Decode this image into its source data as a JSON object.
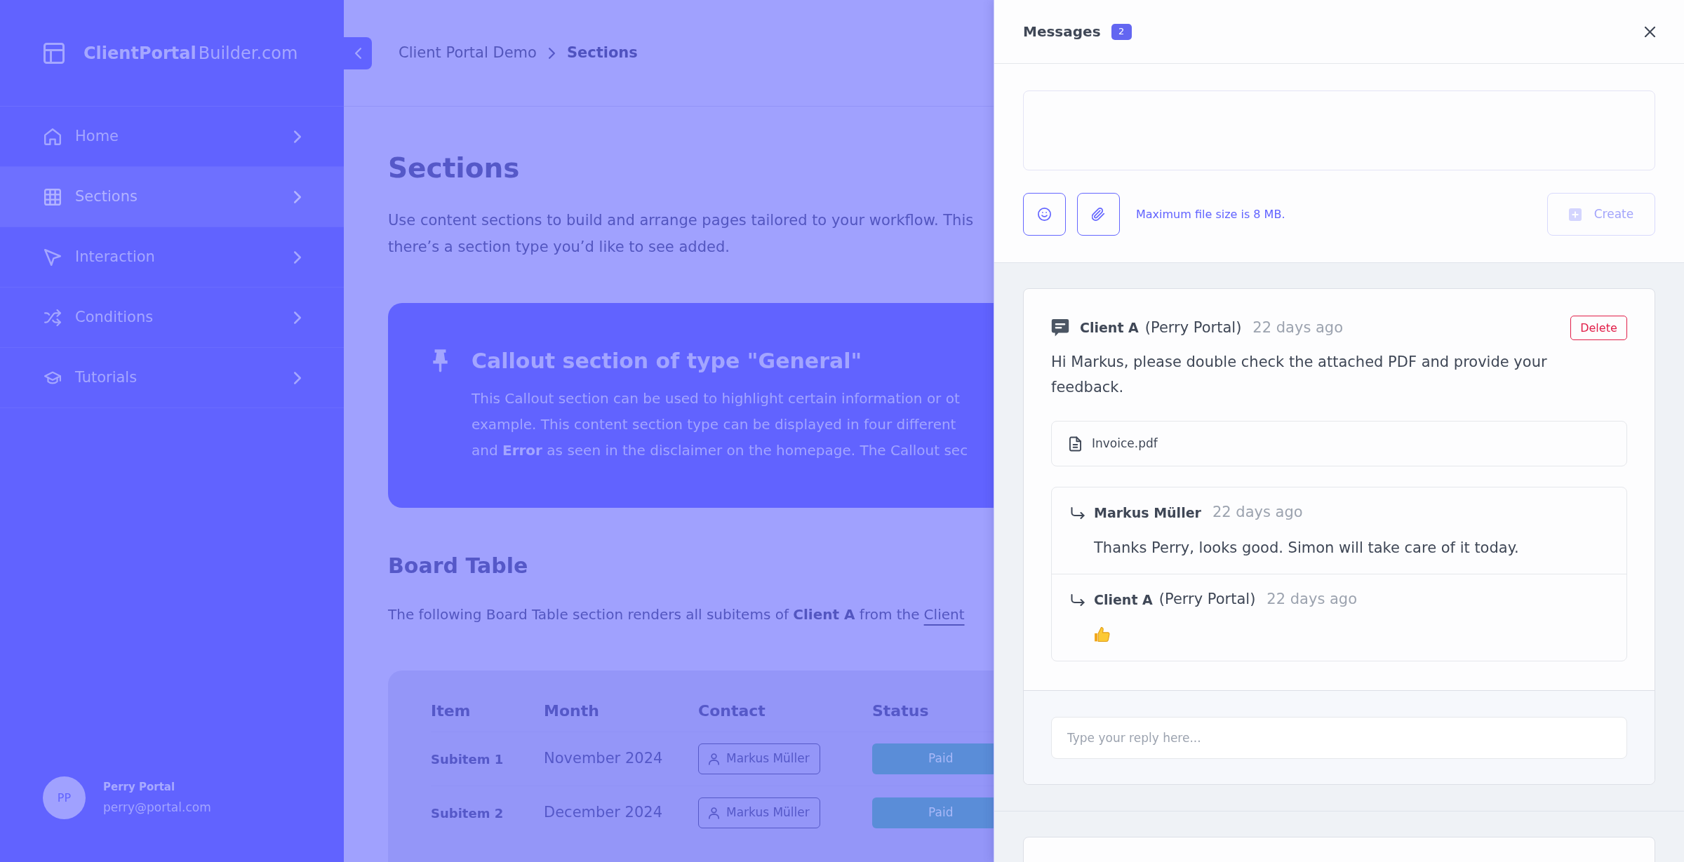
{
  "sidebar": {
    "logo": {
      "bold": "ClientPortal",
      "light": "Builder.com"
    },
    "items": [
      {
        "label": "Home",
        "selected": false
      },
      {
        "label": "Sections",
        "selected": true
      },
      {
        "label": "Interaction",
        "selected": false
      },
      {
        "label": "Conditions",
        "selected": false
      },
      {
        "label": "Tutorials",
        "selected": false
      }
    ],
    "user": {
      "initials": "PP",
      "name": "Perry Portal",
      "email": "perry@portal.com"
    }
  },
  "breadcrumb": [
    {
      "label": "Client Portal Demo",
      "current": false
    },
    {
      "label": "Sections",
      "current": true
    }
  ],
  "page": {
    "title": "Sections",
    "intro_lines": [
      "Use content sections to build and arrange pages tailored to your workflow. This",
      "there’s a section type you’d like to see added."
    ],
    "callout": {
      "title": "Callout section of type \"General\"",
      "lines": [
        "This Callout section can be used to highlight certain information or ot",
        "example. This content section type can be displayed in four different",
        "and **Error** as seen in the disclaimer on the homepage. The Callout sec"
      ]
    },
    "board_table": {
      "title": "Board Table",
      "text": "The following Board Table section renders all subitems of **Client A** from the",
      "link": "Client",
      "columns": [
        "Item",
        "Month",
        "Contact",
        "Status"
      ],
      "rows": [
        {
          "item": "Subitem 1",
          "month": "November 2024",
          "contact": "Markus Müller",
          "status": "Paid"
        },
        {
          "item": "Subitem 2",
          "month": "December 2024",
          "contact": "Markus Müller",
          "status": "Paid"
        }
      ]
    }
  },
  "messages_panel": {
    "title": "Messages",
    "count": "2",
    "composer": {
      "hint": "Maximum file size is 8 MB.",
      "create_label": "Create",
      "create_disabled": true
    },
    "messages": [
      {
        "author": "Client A",
        "org": "(Perry Portal)",
        "time": "22 days ago",
        "delete_label": "Delete",
        "text": "Hi Markus, please double check the attached PDF and provide your feedback.",
        "attachments": [
          "Invoice.pdf"
        ],
        "replies": [
          {
            "kind": "comment",
            "author": "Markus Müller",
            "time": "22 days ago",
            "text": "Thanks Perry, looks good. Simon will take care of it today."
          },
          {
            "kind": "reaction",
            "author": "Client A",
            "org": "(Perry Portal)",
            "time": "22 days ago"
          }
        ],
        "reply_placeholder": "Type your reply here..."
      }
    ]
  }
}
